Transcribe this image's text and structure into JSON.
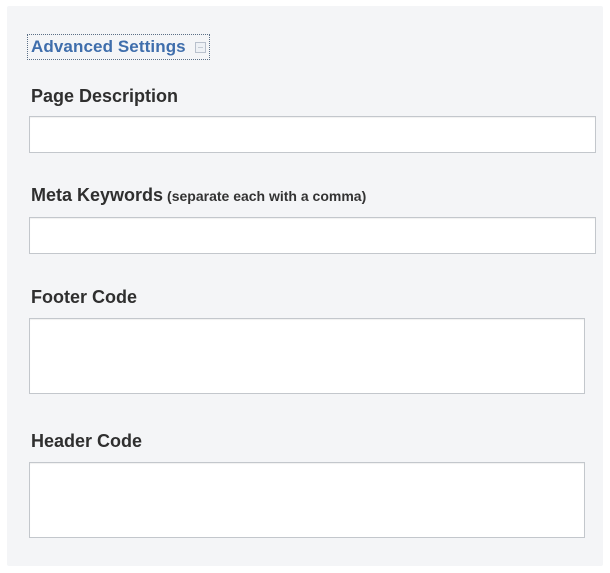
{
  "advanced_settings": {
    "title": "Advanced Settings",
    "toggle_icon": "collapse-icon"
  },
  "fields": {
    "page_description": {
      "label": "Page Description",
      "value": ""
    },
    "meta_keywords": {
      "label": "Meta Keywords",
      "hint": "(separate each with a comma)",
      "value": ""
    },
    "footer_code": {
      "label": "Footer Code",
      "value": ""
    },
    "header_code": {
      "label": "Header Code",
      "value": ""
    }
  },
  "colors": {
    "link_blue": "#3f6eac",
    "panel_background": "#f4f5f7",
    "label_text": "#2f2f2f",
    "input_border": "#c3c7cc"
  }
}
